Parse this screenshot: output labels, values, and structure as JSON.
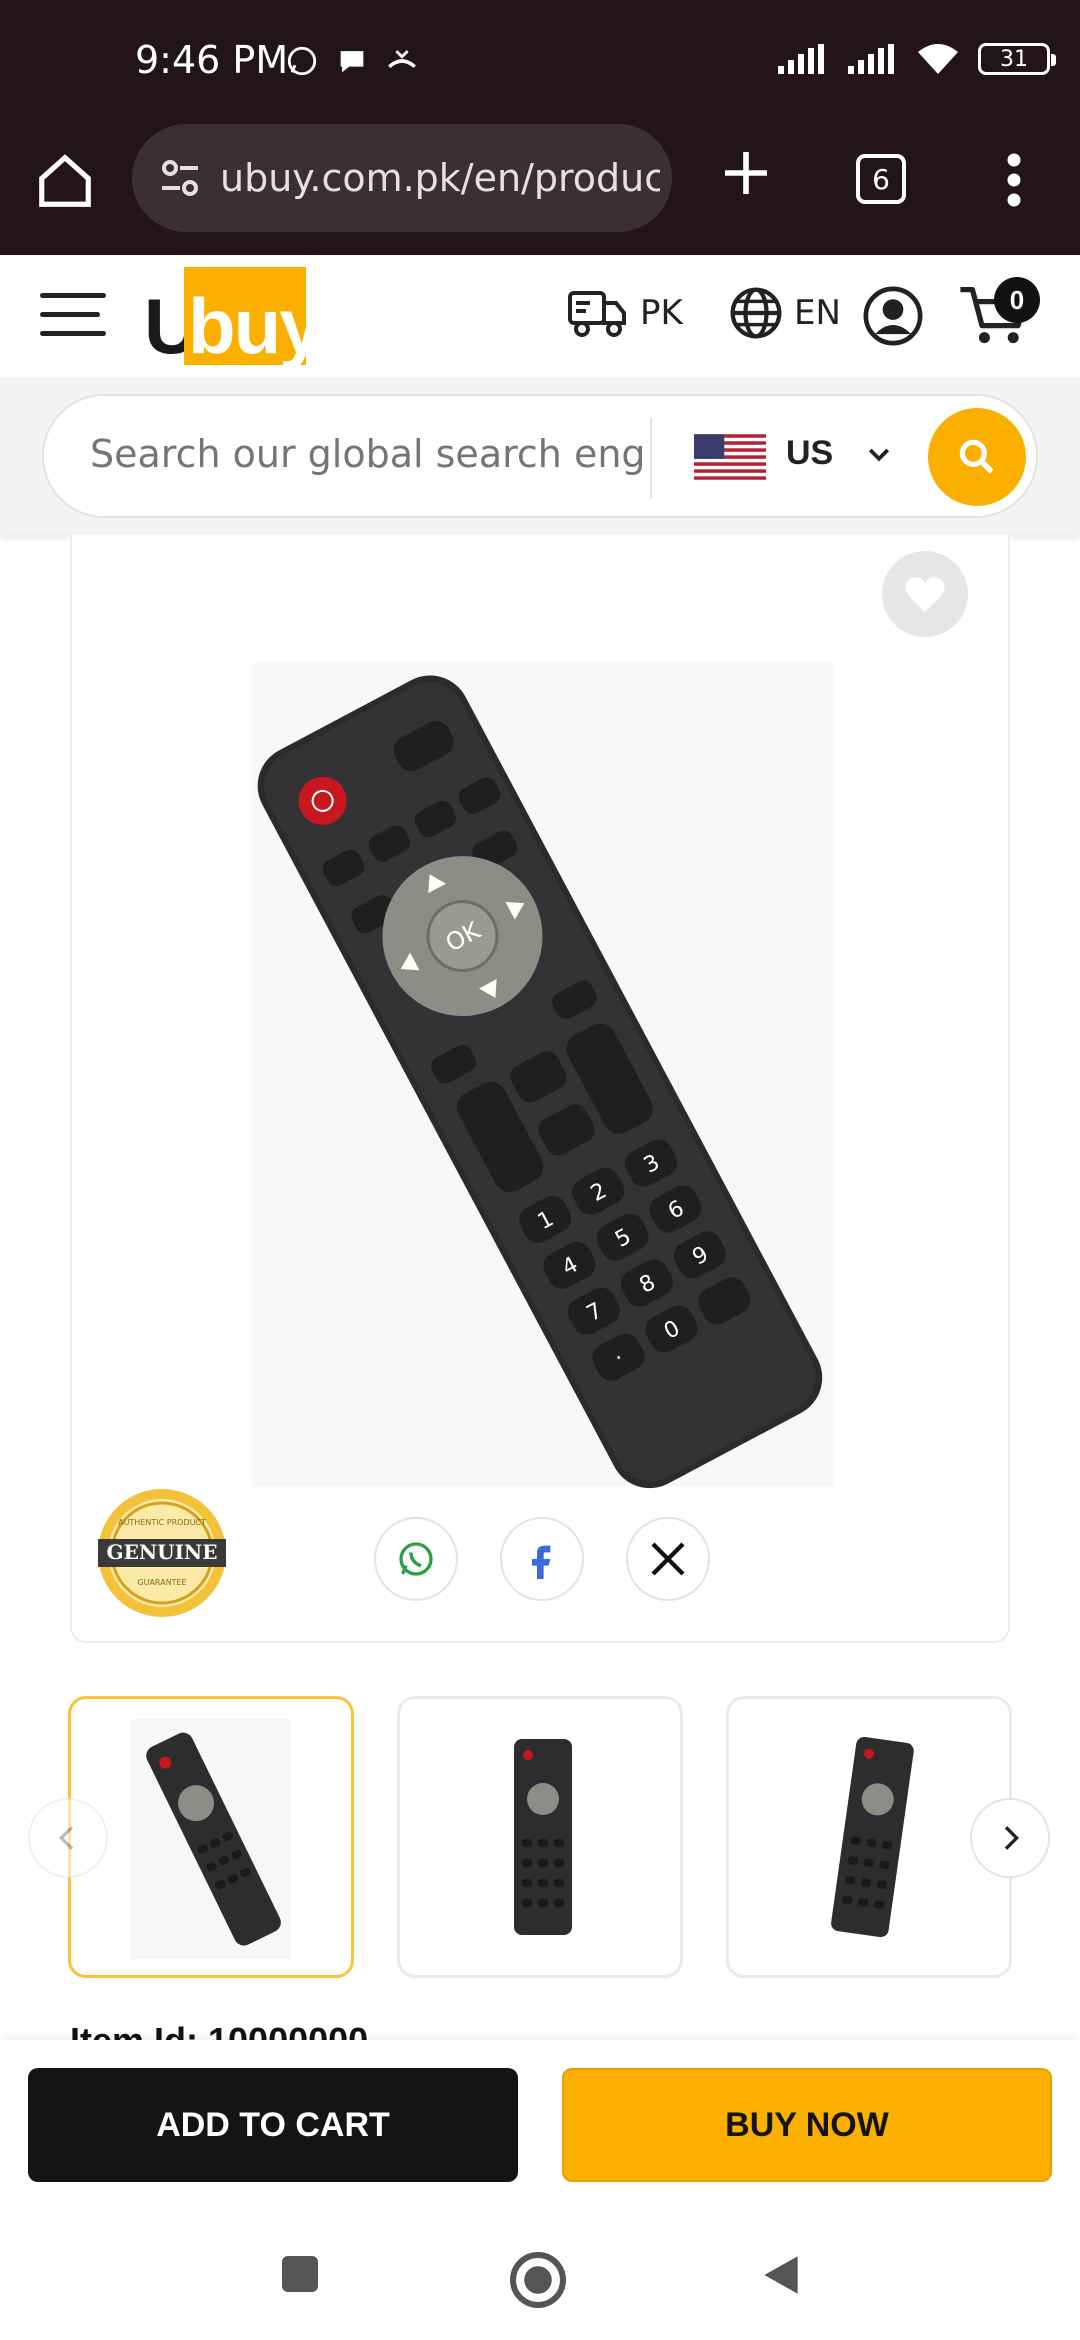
{
  "status": {
    "time": "9:46 PM",
    "battery": "31"
  },
  "browser": {
    "url": "ubuy.com.pk/en/product",
    "tab_count": "6"
  },
  "header": {
    "logo_u": "U",
    "logo_buy": "buy",
    "ship_to": "PK",
    "language": "EN",
    "cart_count": "0"
  },
  "search": {
    "placeholder": "Search our global search eng",
    "country": "US"
  },
  "product": {
    "badge_lines": [
      "AUTHENTIC PRODUCT",
      "GENUINE",
      "GUARANTEE"
    ],
    "item_id_partial": "Item Id: 10000000"
  },
  "actions": {
    "add_to_cart": "ADD TO CART",
    "buy_now": "BUY NOW"
  },
  "colors": {
    "brand_yellow": "#fbb000",
    "chrome_bg": "#221418",
    "dark_button": "#141414"
  },
  "icons": [
    "home-icon",
    "site-settings-icon",
    "plus-icon",
    "tabs-icon",
    "more-icon",
    "menu-icon",
    "truck-icon",
    "globe-icon",
    "account-icon",
    "cart-icon",
    "us-flag-icon",
    "chevron-down-icon",
    "search-icon",
    "heart-icon",
    "whatsapp-icon",
    "facebook-icon",
    "x-icon",
    "chevron-left-icon",
    "chevron-right-icon"
  ]
}
